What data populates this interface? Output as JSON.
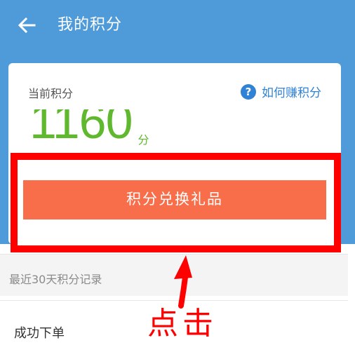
{
  "header": {
    "title": "我的积分",
    "back_icon": "arrow-left-icon"
  },
  "summary": {
    "current_points_label": "当前积分",
    "how_to_earn_label": "如何赚积分",
    "help_icon": "question-circle-icon",
    "help_icon_glyph": "?",
    "points_value": "1160",
    "points_unit": "分"
  },
  "actions": {
    "redeem_label": "积分兑换礼品"
  },
  "history": {
    "section_title": "最近30天积分记录",
    "items": [
      {
        "label": "成功下单"
      }
    ]
  },
  "annotation": {
    "text": "点击",
    "arrow_icon": "red-arrow-up-icon"
  },
  "colors": {
    "header_bg": "#4f9bd9",
    "points_green": "#5fb82d",
    "button_orange": "#f86e4a",
    "link_blue": "#2f82d4",
    "annotation_red": "#ff0000"
  }
}
